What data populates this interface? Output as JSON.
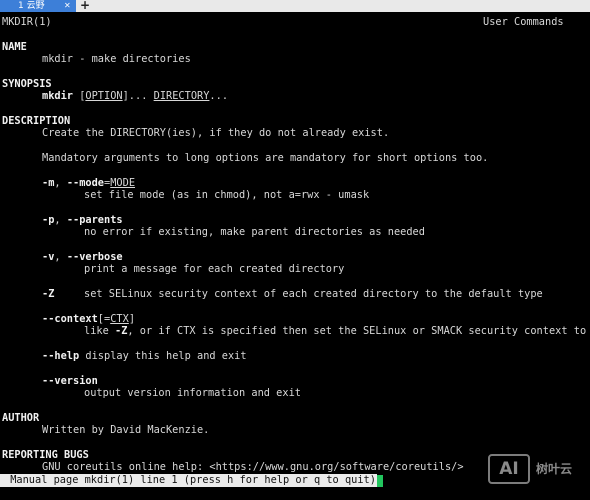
{
  "tab": {
    "title": "1 云野",
    "close_glyph": "✕",
    "add_glyph": "+"
  },
  "header": {
    "left": "MKDIR(1)",
    "right": "User Commands"
  },
  "sections": {
    "name": {
      "heading": "NAME",
      "text": "mkdir - make directories"
    },
    "synopsis": {
      "heading": "SYNOPSIS",
      "cmd": "mkdir",
      "sp1": " ",
      "bracket_open": "[",
      "option": "OPTION",
      "bracket_close_dots": "]...",
      "sp2": " ",
      "directory": "DIRECTORY",
      "trailing": "..."
    },
    "description": {
      "heading": "DESCRIPTION",
      "line1": "Create the DIRECTORY(ies), if they do not already exist.",
      "line2": "Mandatory arguments to long options are mandatory for short options too."
    },
    "mode": {
      "short": "-m",
      "comma": ", ",
      "long": "--mode",
      "eq": "=",
      "arg": "MODE",
      "desc": "set file mode (as in chmod), not a=rwx - umask"
    },
    "parents": {
      "short": "-p",
      "comma": ", ",
      "long": "--parents",
      "desc": "no error if existing, make parent directories as needed"
    },
    "verbose": {
      "short": "-v",
      "comma": ", ",
      "long": "--verbose",
      "desc": "print a message for each created directory"
    },
    "z": {
      "flag": "-Z",
      "desc": "set SELinux security context of each created directory to the default type"
    },
    "context": {
      "long": "--context",
      "opt_open": "[=",
      "arg": "CTX",
      "opt_close": "]",
      "desc_pre": "like ",
      "desc_flag": "-Z",
      "desc_post": ", or if CTX is specified then set the SELinux or SMACK security context to CTX"
    },
    "help": {
      "flag": "--help",
      "desc": " display this help and exit"
    },
    "version": {
      "flag": "--version",
      "desc": "output version information and exit"
    },
    "author": {
      "heading": "AUTHOR",
      "text": "Written by David MacKenzie."
    },
    "bugs": {
      "heading": "REPORTING BUGS",
      "text": "GNU coreutils online help: <https://www.gnu.org/software/coreutils/>"
    }
  },
  "status": {
    "text": " Manual page mkdir(1) line 1 (press h for help or q to quit)"
  },
  "watermark": {
    "logo": "AI",
    "name": "树叶云"
  },
  "colors": {
    "tab_active": "#3d7fd8",
    "tabbar_bg": "#e9e9e9",
    "terminal_bg": "#000000",
    "terminal_fg": "#d8d8d8",
    "cursor": "#22c55e"
  }
}
